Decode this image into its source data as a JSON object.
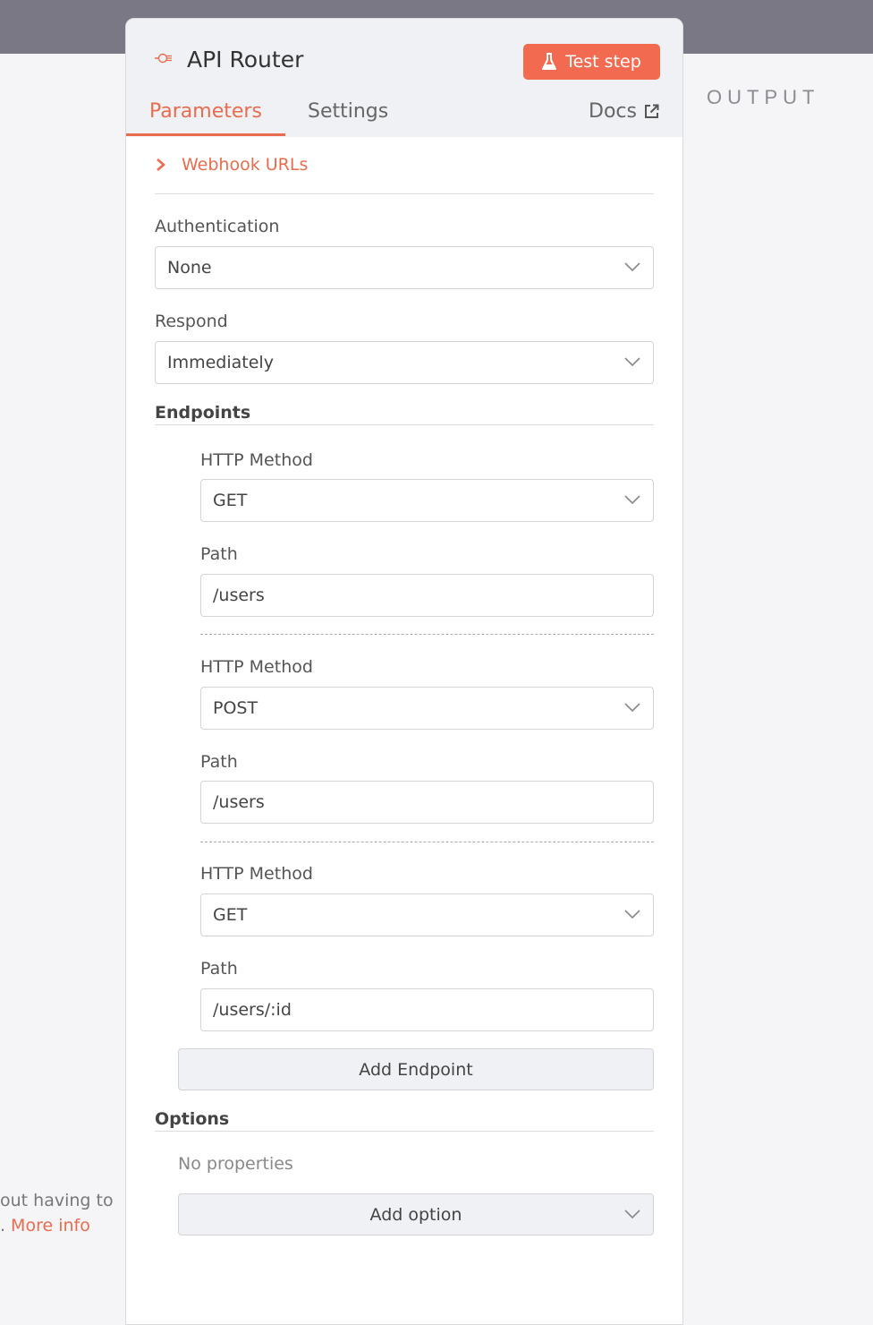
{
  "node": {
    "title": "API Router",
    "test_button": "Test step",
    "tabs": {
      "parameters": "Parameters",
      "settings": "Settings",
      "docs": "Docs"
    }
  },
  "webhook_urls": "Webhook URLs",
  "authentication": {
    "label": "Authentication",
    "value": "None"
  },
  "respond": {
    "label": "Respond",
    "value": "Immediately"
  },
  "endpoints": {
    "label": "Endpoints",
    "items": [
      {
        "method_label": "HTTP Method",
        "method": "GET",
        "path_label": "Path",
        "path": "/users"
      },
      {
        "method_label": "HTTP Method",
        "method": "POST",
        "path_label": "Path",
        "path": "/users"
      },
      {
        "method_label": "HTTP Method",
        "method": "GET",
        "path_label": "Path",
        "path": "/users/:id"
      }
    ],
    "add_button": "Add Endpoint"
  },
  "options": {
    "label": "Options",
    "empty_text": "No properties",
    "add_button": "Add option"
  },
  "output_label": "OUTPUT",
  "left_hint": {
    "line1": "out having to",
    "line2_prefix": ".",
    "link": "More info"
  },
  "colors": {
    "accent": "#ea6c4e",
    "button": "#f26b51",
    "topbar": "#7a7884"
  }
}
